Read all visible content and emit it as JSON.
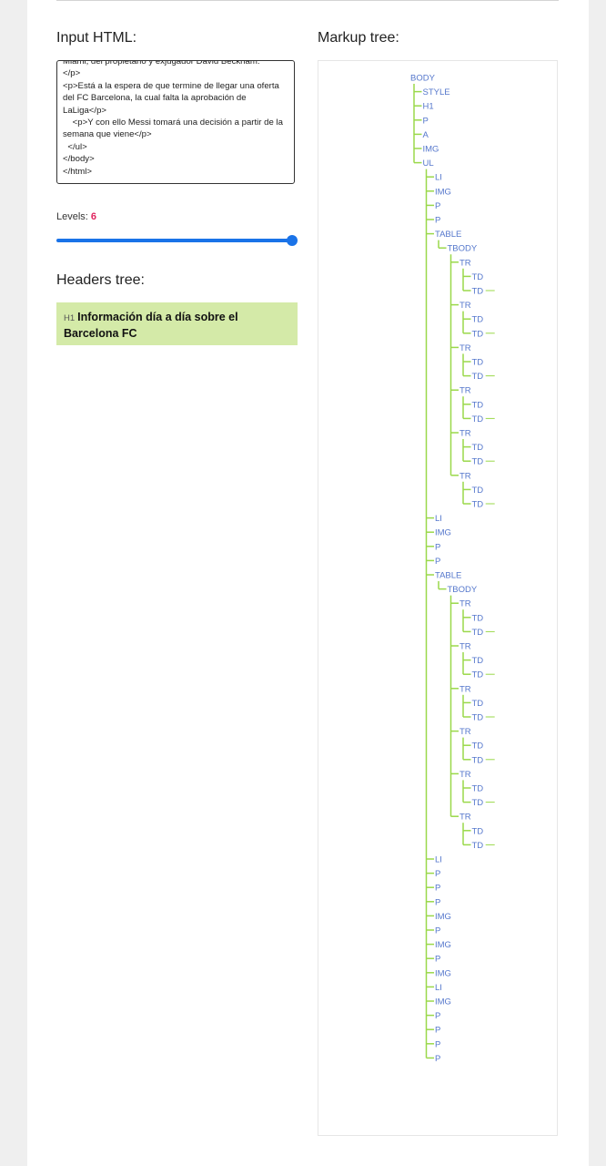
{
  "labels": {
    "input_html": "Input HTML:",
    "markup_tree": "Markup tree:",
    "headers_tree": "Headers tree:",
    "levels": "Levels:"
  },
  "input_html": {
    "value": "Miami, del propietario y exjugador David Beckham.\n</p>\n<p>Está a la espera de que termine de llegar una oferta del FC Barcelona, la cual falta la aprobación de LaLiga</p>\n    <p>Y con ello Messi tomará una decisión a partir de la semana que viene</p>\n  </ul>\n</body>\n</html>"
  },
  "levels": {
    "value": "6",
    "slider_fraction": 1.0
  },
  "headers_tree": [
    {
      "tag": "H1",
      "text": "Información día a día sobre el Barcelona FC"
    }
  ],
  "colors": {
    "tree_line": "#9ad84a",
    "tree_text": "#5577cc",
    "accent": "#1a73e8",
    "level_value": "#e0245e",
    "header_bg": "#d4eaa8"
  },
  "markup_tree": {
    "tag": "BODY",
    "children": [
      {
        "tag": "STYLE"
      },
      {
        "tag": "H1"
      },
      {
        "tag": "P"
      },
      {
        "tag": "A"
      },
      {
        "tag": "IMG"
      },
      {
        "tag": "UL",
        "children": [
          {
            "tag": "LI"
          },
          {
            "tag": "IMG"
          },
          {
            "tag": "P"
          },
          {
            "tag": "P"
          },
          {
            "tag": "TABLE",
            "children": [
              {
                "tag": "TBODY",
                "children": [
                  {
                    "tag": "TR",
                    "children": [
                      {
                        "tag": "TD"
                      },
                      {
                        "tag": "TD",
                        "more": true
                      }
                    ]
                  },
                  {
                    "tag": "TR",
                    "children": [
                      {
                        "tag": "TD"
                      },
                      {
                        "tag": "TD",
                        "more": true
                      }
                    ]
                  },
                  {
                    "tag": "TR",
                    "children": [
                      {
                        "tag": "TD"
                      },
                      {
                        "tag": "TD",
                        "more": true
                      }
                    ]
                  },
                  {
                    "tag": "TR",
                    "children": [
                      {
                        "tag": "TD"
                      },
                      {
                        "tag": "TD",
                        "more": true
                      }
                    ]
                  },
                  {
                    "tag": "TR",
                    "children": [
                      {
                        "tag": "TD"
                      },
                      {
                        "tag": "TD",
                        "more": true
                      }
                    ]
                  },
                  {
                    "tag": "TR",
                    "children": [
                      {
                        "tag": "TD"
                      },
                      {
                        "tag": "TD",
                        "more": true
                      }
                    ]
                  }
                ]
              }
            ]
          },
          {
            "tag": "LI"
          },
          {
            "tag": "IMG"
          },
          {
            "tag": "P"
          },
          {
            "tag": "P"
          },
          {
            "tag": "TABLE",
            "children": [
              {
                "tag": "TBODY",
                "children": [
                  {
                    "tag": "TR",
                    "children": [
                      {
                        "tag": "TD"
                      },
                      {
                        "tag": "TD",
                        "more": true
                      }
                    ]
                  },
                  {
                    "tag": "TR",
                    "children": [
                      {
                        "tag": "TD"
                      },
                      {
                        "tag": "TD",
                        "more": true
                      }
                    ]
                  },
                  {
                    "tag": "TR",
                    "children": [
                      {
                        "tag": "TD"
                      },
                      {
                        "tag": "TD",
                        "more": true
                      }
                    ]
                  },
                  {
                    "tag": "TR",
                    "children": [
                      {
                        "tag": "TD"
                      },
                      {
                        "tag": "TD",
                        "more": true
                      }
                    ]
                  },
                  {
                    "tag": "TR",
                    "children": [
                      {
                        "tag": "TD"
                      },
                      {
                        "tag": "TD",
                        "more": true
                      }
                    ]
                  },
                  {
                    "tag": "TR",
                    "children": [
                      {
                        "tag": "TD"
                      },
                      {
                        "tag": "TD",
                        "more": true
                      }
                    ]
                  }
                ]
              }
            ]
          },
          {
            "tag": "LI"
          },
          {
            "tag": "P"
          },
          {
            "tag": "P"
          },
          {
            "tag": "P"
          },
          {
            "tag": "IMG"
          },
          {
            "tag": "P"
          },
          {
            "tag": "IMG"
          },
          {
            "tag": "P"
          },
          {
            "tag": "IMG"
          },
          {
            "tag": "LI"
          },
          {
            "tag": "IMG"
          },
          {
            "tag": "P"
          },
          {
            "tag": "P"
          },
          {
            "tag": "P"
          },
          {
            "tag": "P"
          }
        ]
      }
    ]
  }
}
